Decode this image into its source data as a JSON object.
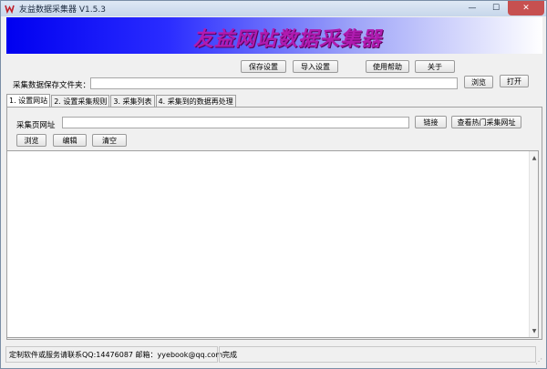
{
  "window": {
    "title": "友益数据采集器 V1.5.3",
    "controls": {
      "minimize": "—",
      "maximize": "☐",
      "close": "✕"
    }
  },
  "banner": {
    "title": "友益网站数据采集器"
  },
  "toolbar": {
    "save_settings": "保存设置",
    "import_settings": "导入设置",
    "help": "使用帮助",
    "about": "关于"
  },
  "save_folder": {
    "label": "采集数据保存文件夹：",
    "value": "",
    "browse": "浏览",
    "open": "打开"
  },
  "tabs": [
    {
      "label": "1. 设置网站",
      "active": true
    },
    {
      "label": "2. 设置采集规则",
      "active": false
    },
    {
      "label": "3. 采集列表",
      "active": false
    },
    {
      "label": "4. 采集到的数据再处理",
      "active": false
    }
  ],
  "site": {
    "url_label": "采集页网址",
    "url_value": "",
    "link": "链接",
    "view_hot": "查看热门采集网址",
    "browse": "浏览",
    "edit": "编辑",
    "clear": "清空"
  },
  "content": {
    "text": ""
  },
  "status": {
    "contact": "定制软件或服务请联系QQ:14476087 邮箱：yyebook@qq.com",
    "state": "完成"
  }
}
